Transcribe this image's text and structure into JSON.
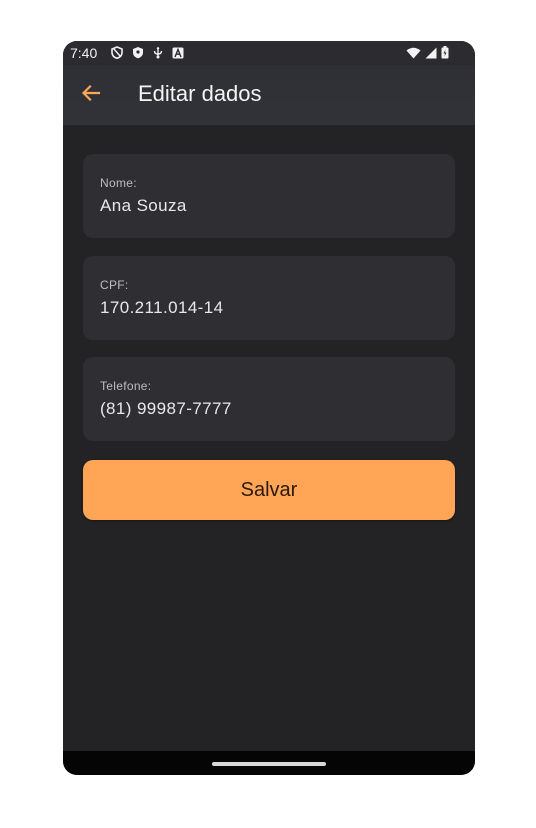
{
  "status_bar": {
    "time": "7:40",
    "left_icons": [
      "shield-outline-icon",
      "shield-filled-icon",
      "usb-icon",
      "a-box-icon"
    ],
    "right_icons": [
      "wifi-icon",
      "signal-icon",
      "battery-icon"
    ]
  },
  "app_bar": {
    "title": "Editar dados",
    "back_icon": "arrow-left-icon",
    "accent_color": "#ffa555"
  },
  "form": {
    "fields": [
      {
        "label": "Nome:",
        "value": "Ana Souza"
      },
      {
        "label": "CPF:",
        "value": "170.211.014-14"
      },
      {
        "label": "Telefone:",
        "value": "(81) 99987-7777"
      }
    ],
    "save_label": "Salvar"
  },
  "colors": {
    "background": "#232326",
    "field_background": "#2f2f33",
    "button": "#ffa555"
  }
}
